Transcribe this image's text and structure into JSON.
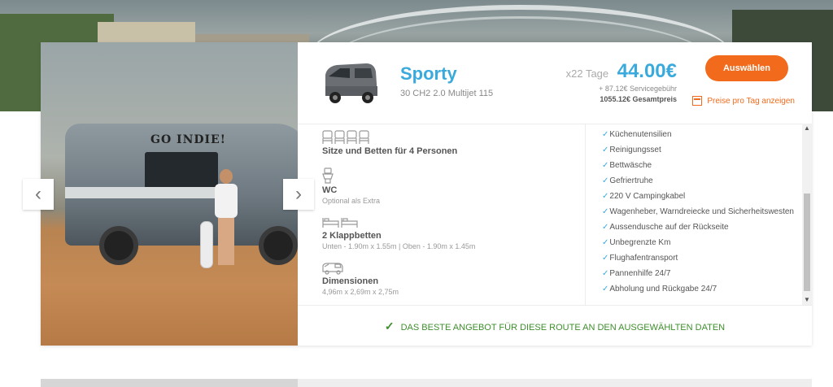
{
  "vehicle": {
    "name": "Sporty",
    "model": "30 CH2 2.0 Multijet 115"
  },
  "pricing": {
    "days": "x22 Tage",
    "price": "44.00€",
    "service_fee": "+ 87.12€ Servicegebühr",
    "total": "1055.12€ Gesamtpreis",
    "select_label": "Auswählen",
    "daily_prices_link": "Preise pro Tag anzeigen"
  },
  "photo": {
    "van_text": "GO INDIE!",
    "prev_label": "‹",
    "next_label": "›"
  },
  "features": [
    {
      "icon": "seat-icon",
      "title": "Sitze und Betten für 4 Personen",
      "sub": ""
    },
    {
      "icon": "toilet-icon",
      "title": "WC",
      "sub": "Optional als Extra"
    },
    {
      "icon": "bed-icon",
      "title": "2 Klappbetten",
      "sub": "Unten - 1.90m x 1.55m | Oben - 1.90m x 1.45m"
    },
    {
      "icon": "dimensions-icon",
      "title": "Dimensionen",
      "sub": "4,96m x 2,69m x 2,75m"
    }
  ],
  "equipment": [
    "Küchenutensilien",
    "Reinigungsset",
    "Bettwäsche",
    "Gefriertruhe",
    "220 V Campingkabel",
    "Wagenheber, Warndreiecke und Sicherheitswesten",
    "Aussendusche auf der Rückseite",
    "Unbegrenzte Km",
    "Flughafentransport",
    "Pannenhilfe 24/7",
    "Abholung und Rückgabe 24/7"
  ],
  "footer": {
    "best_offer": "DAS BESTE ANGEBOT FÜR DIESE ROUTE AN DEN AUSGEWÄHLTEN DATEN"
  },
  "colors": {
    "accent_blue": "#3aaadc",
    "accent_orange": "#f26a1b",
    "success_green": "#3d8f2b"
  }
}
